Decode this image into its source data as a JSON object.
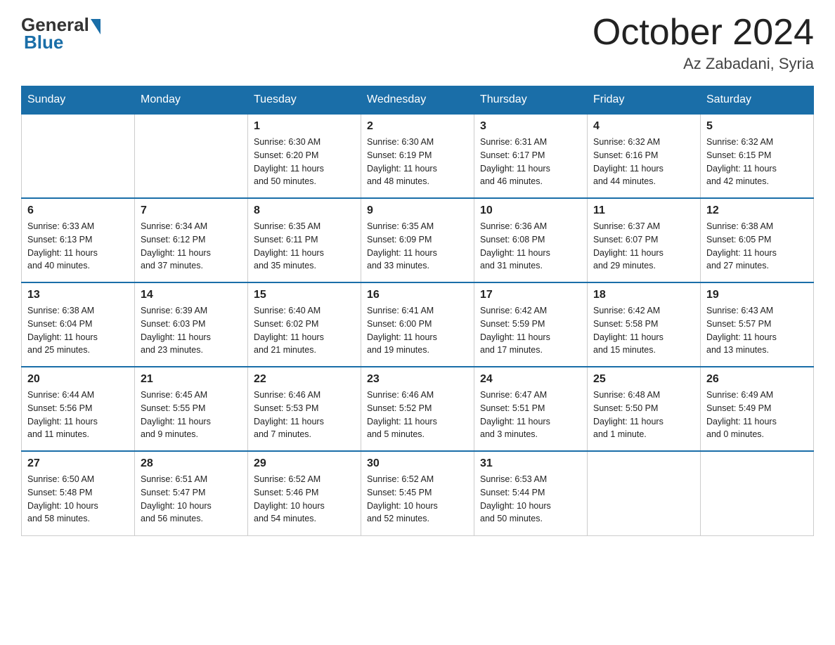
{
  "header": {
    "logo_general": "General",
    "logo_blue": "Blue",
    "month": "October 2024",
    "location": "Az Zabadani, Syria"
  },
  "days_of_week": [
    "Sunday",
    "Monday",
    "Tuesday",
    "Wednesday",
    "Thursday",
    "Friday",
    "Saturday"
  ],
  "weeks": [
    [
      {
        "day": "",
        "info": ""
      },
      {
        "day": "",
        "info": ""
      },
      {
        "day": "1",
        "info": "Sunrise: 6:30 AM\nSunset: 6:20 PM\nDaylight: 11 hours\nand 50 minutes."
      },
      {
        "day": "2",
        "info": "Sunrise: 6:30 AM\nSunset: 6:19 PM\nDaylight: 11 hours\nand 48 minutes."
      },
      {
        "day": "3",
        "info": "Sunrise: 6:31 AM\nSunset: 6:17 PM\nDaylight: 11 hours\nand 46 minutes."
      },
      {
        "day": "4",
        "info": "Sunrise: 6:32 AM\nSunset: 6:16 PM\nDaylight: 11 hours\nand 44 minutes."
      },
      {
        "day": "5",
        "info": "Sunrise: 6:32 AM\nSunset: 6:15 PM\nDaylight: 11 hours\nand 42 minutes."
      }
    ],
    [
      {
        "day": "6",
        "info": "Sunrise: 6:33 AM\nSunset: 6:13 PM\nDaylight: 11 hours\nand 40 minutes."
      },
      {
        "day": "7",
        "info": "Sunrise: 6:34 AM\nSunset: 6:12 PM\nDaylight: 11 hours\nand 37 minutes."
      },
      {
        "day": "8",
        "info": "Sunrise: 6:35 AM\nSunset: 6:11 PM\nDaylight: 11 hours\nand 35 minutes."
      },
      {
        "day": "9",
        "info": "Sunrise: 6:35 AM\nSunset: 6:09 PM\nDaylight: 11 hours\nand 33 minutes."
      },
      {
        "day": "10",
        "info": "Sunrise: 6:36 AM\nSunset: 6:08 PM\nDaylight: 11 hours\nand 31 minutes."
      },
      {
        "day": "11",
        "info": "Sunrise: 6:37 AM\nSunset: 6:07 PM\nDaylight: 11 hours\nand 29 minutes."
      },
      {
        "day": "12",
        "info": "Sunrise: 6:38 AM\nSunset: 6:05 PM\nDaylight: 11 hours\nand 27 minutes."
      }
    ],
    [
      {
        "day": "13",
        "info": "Sunrise: 6:38 AM\nSunset: 6:04 PM\nDaylight: 11 hours\nand 25 minutes."
      },
      {
        "day": "14",
        "info": "Sunrise: 6:39 AM\nSunset: 6:03 PM\nDaylight: 11 hours\nand 23 minutes."
      },
      {
        "day": "15",
        "info": "Sunrise: 6:40 AM\nSunset: 6:02 PM\nDaylight: 11 hours\nand 21 minutes."
      },
      {
        "day": "16",
        "info": "Sunrise: 6:41 AM\nSunset: 6:00 PM\nDaylight: 11 hours\nand 19 minutes."
      },
      {
        "day": "17",
        "info": "Sunrise: 6:42 AM\nSunset: 5:59 PM\nDaylight: 11 hours\nand 17 minutes."
      },
      {
        "day": "18",
        "info": "Sunrise: 6:42 AM\nSunset: 5:58 PM\nDaylight: 11 hours\nand 15 minutes."
      },
      {
        "day": "19",
        "info": "Sunrise: 6:43 AM\nSunset: 5:57 PM\nDaylight: 11 hours\nand 13 minutes."
      }
    ],
    [
      {
        "day": "20",
        "info": "Sunrise: 6:44 AM\nSunset: 5:56 PM\nDaylight: 11 hours\nand 11 minutes."
      },
      {
        "day": "21",
        "info": "Sunrise: 6:45 AM\nSunset: 5:55 PM\nDaylight: 11 hours\nand 9 minutes."
      },
      {
        "day": "22",
        "info": "Sunrise: 6:46 AM\nSunset: 5:53 PM\nDaylight: 11 hours\nand 7 minutes."
      },
      {
        "day": "23",
        "info": "Sunrise: 6:46 AM\nSunset: 5:52 PM\nDaylight: 11 hours\nand 5 minutes."
      },
      {
        "day": "24",
        "info": "Sunrise: 6:47 AM\nSunset: 5:51 PM\nDaylight: 11 hours\nand 3 minutes."
      },
      {
        "day": "25",
        "info": "Sunrise: 6:48 AM\nSunset: 5:50 PM\nDaylight: 11 hours\nand 1 minute."
      },
      {
        "day": "26",
        "info": "Sunrise: 6:49 AM\nSunset: 5:49 PM\nDaylight: 11 hours\nand 0 minutes."
      }
    ],
    [
      {
        "day": "27",
        "info": "Sunrise: 6:50 AM\nSunset: 5:48 PM\nDaylight: 10 hours\nand 58 minutes."
      },
      {
        "day": "28",
        "info": "Sunrise: 6:51 AM\nSunset: 5:47 PM\nDaylight: 10 hours\nand 56 minutes."
      },
      {
        "day": "29",
        "info": "Sunrise: 6:52 AM\nSunset: 5:46 PM\nDaylight: 10 hours\nand 54 minutes."
      },
      {
        "day": "30",
        "info": "Sunrise: 6:52 AM\nSunset: 5:45 PM\nDaylight: 10 hours\nand 52 minutes."
      },
      {
        "day": "31",
        "info": "Sunrise: 6:53 AM\nSunset: 5:44 PM\nDaylight: 10 hours\nand 50 minutes."
      },
      {
        "day": "",
        "info": ""
      },
      {
        "day": "",
        "info": ""
      }
    ]
  ]
}
